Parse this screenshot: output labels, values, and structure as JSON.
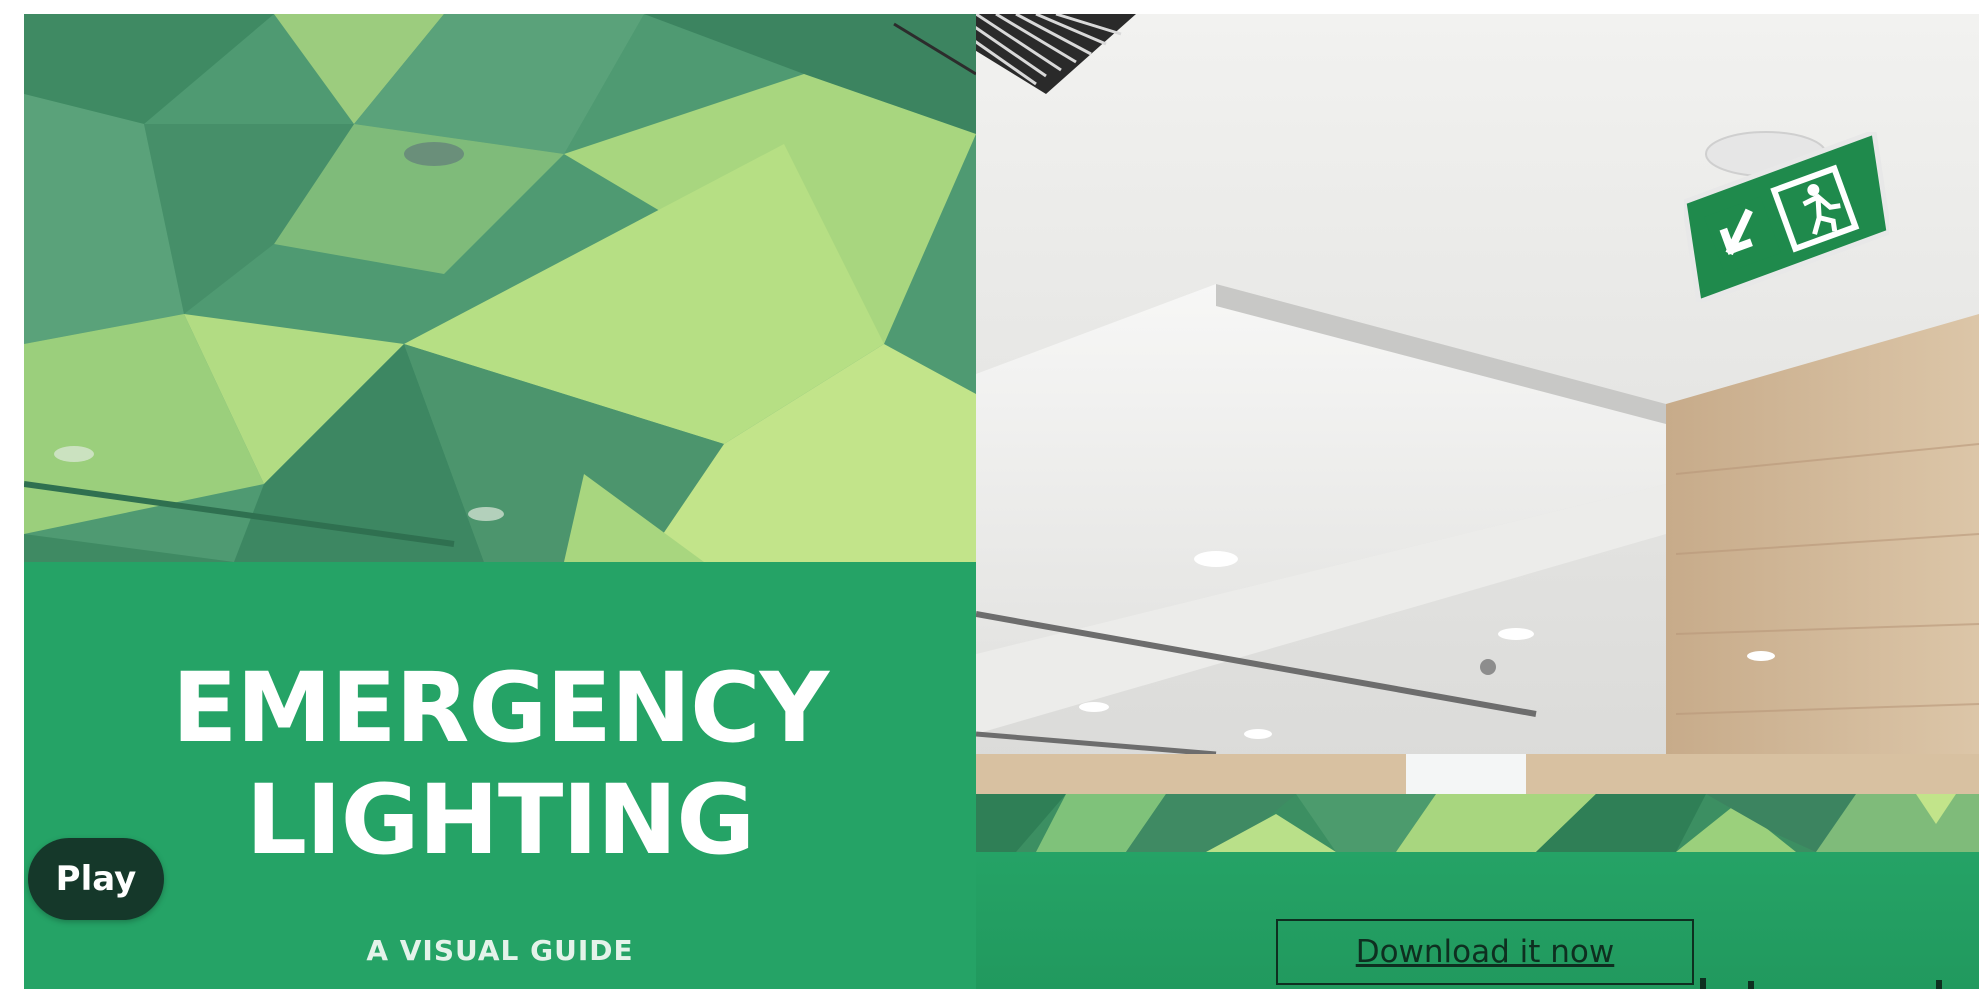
{
  "cover": {
    "title_line_1": "EMERGENCY",
    "title_line_2": "LIGHTING",
    "subtitle": "A VISUAL GUIDE"
  },
  "controls": {
    "play_label": "Play",
    "download_label": "Download it now"
  },
  "colors": {
    "brand_green": "#25a366",
    "dark_green": "#15382a",
    "light_green": "#a9d77c",
    "exit_sign_green": "#1f8a4c"
  },
  "icons": {
    "exit_sign": "running-man-exit-icon",
    "arrow": "arrow-down-left-icon"
  }
}
